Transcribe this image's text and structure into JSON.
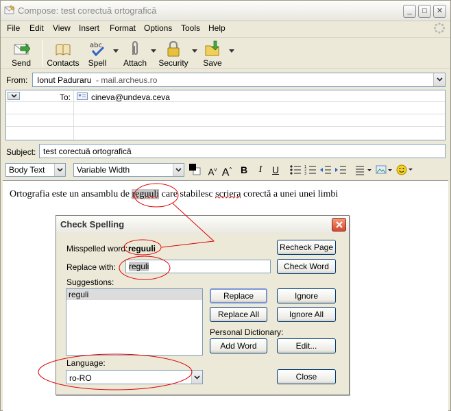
{
  "window": {
    "title": "Compose: test corectuă  ortografică",
    "minimize_glyph": "_",
    "maximize_glyph": "□",
    "close_glyph": "✕"
  },
  "menu": [
    "File",
    "Edit",
    "View",
    "Insert",
    "Format",
    "Options",
    "Tools",
    "Help"
  ],
  "toolbar": {
    "send": "Send",
    "contacts": "Contacts",
    "spell": "Spell",
    "attach": "Attach",
    "security": "Security",
    "save": "Save"
  },
  "from": {
    "label": "From:",
    "name": "Ionut Paduraru",
    "account": "- mail.archeus.ro"
  },
  "recipients": {
    "type_label": "To:",
    "address": "cineva@undeva.ceva"
  },
  "subject": {
    "label": "Subject:",
    "value": "test corectuă  ortografică"
  },
  "format": {
    "paragraph_style": "Body Text",
    "font": "Variable Width",
    "bold": "B",
    "italic": "I",
    "underline": "U"
  },
  "body": {
    "before": "Ortografia este un ansamblu de ",
    "highlighted": "reguuli",
    "middle": " care stabilesc ",
    "misspelled2": "scriera",
    "after": " corectă a unei unei limbi"
  },
  "spell_dialog": {
    "title": "Check Spelling",
    "misspelled_label": "Misspelled word:",
    "misspelled_value": "reguuli",
    "replace_label": "Replace with:",
    "replace_value": "reguli",
    "suggestions_label": "Suggestions:",
    "suggestions": [
      "reguli"
    ],
    "recheck": "Recheck Page",
    "check_word": "Check Word",
    "replace": "Replace",
    "ignore": "Ignore",
    "replace_all": "Replace All",
    "ignore_all": "Ignore All",
    "personal_dictionary_label": "Personal Dictionary:",
    "add_word": "Add Word",
    "edit": "Edit...",
    "language_label": "Language:",
    "language_value": "ro-RO",
    "close": "Close"
  },
  "annotation_color": "#e00000"
}
